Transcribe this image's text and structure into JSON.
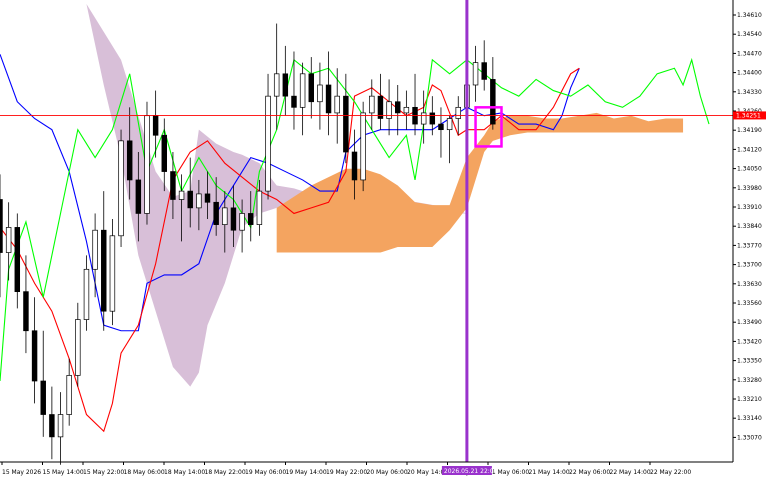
{
  "chart_data": {
    "type": "candlestick",
    "title": "",
    "xlabel": "",
    "ylabel": "",
    "ylim": [
      1.3301,
      1.3465
    ],
    "y_ticks": [
      "1.34610",
      "1.34540",
      "1.34470",
      "1.34400",
      "1.34330",
      "1.34260",
      "1.34190",
      "1.34120",
      "1.34050",
      "1.33980",
      "1.33910",
      "1.33840",
      "1.33770",
      "1.33700",
      "1.33630",
      "1.33560",
      "1.33490",
      "1.33420",
      "1.33350",
      "1.33280",
      "1.33210",
      "1.33140",
      "1.33070"
    ],
    "x_ticks": [
      "15 May 2026",
      "15 May 14:00",
      "15 May 22:00",
      "18 May 06:00",
      "18 May 14:00",
      "18 May 22:00",
      "19 May 06:00",
      "19 May 14:00",
      "19 May 22:00",
      "20 May 06:00",
      "20 May 14:00",
      "20 May 22:00",
      "21 May 06:00",
      "21 May 14:00",
      "22 May 06:00",
      "22 May 14:00",
      "22 May 22:00"
    ],
    "current_price": "1.34251",
    "current_price_value": 1.34251,
    "marker_label": "2026.05.21 22:00",
    "grid": false,
    "colors": {
      "background": "#ffffff",
      "tenkan": "#ff0000",
      "kijun": "#0000ff",
      "chikou": "#00ff00",
      "cloud_bear": "#d8bfd8",
      "cloud_bull": "#f4a460",
      "marker_line": "#9932cc",
      "box": "#ff00ff",
      "price_line": "#ff0000",
      "candle": "#000000"
    },
    "series": [
      {
        "name": "kumo_bear_top",
        "points": [
          [
            10,
            1.3465
          ],
          [
            12,
            1.3455
          ],
          [
            14,
            1.3445
          ],
          [
            16,
            1.3425
          ],
          [
            18,
            1.3405
          ],
          [
            20,
            1.3396
          ],
          [
            22,
            1.3398
          ],
          [
            23,
            1.342
          ],
          [
            25,
            1.3415
          ],
          [
            27,
            1.3412
          ],
          [
            28,
            1.3411
          ],
          [
            30,
            1.3408
          ],
          [
            32,
            1.34
          ],
          [
            34,
            1.3399
          ],
          [
            36,
            1.3397
          ],
          [
            37,
            1.34
          ],
          [
            52,
            1.3392
          ],
          [
            54,
            1.339
          ]
        ]
      },
      {
        "name": "kumo_bear_bottom",
        "points": [
          [
            10,
            1.3465
          ],
          [
            12,
            1.3436
          ],
          [
            14,
            1.341
          ],
          [
            16,
            1.3375
          ],
          [
            18,
            1.3355
          ],
          [
            20,
            1.3335
          ],
          [
            22,
            1.3328
          ],
          [
            23,
            1.3333
          ],
          [
            24,
            1.335
          ],
          [
            26,
            1.3365
          ],
          [
            28,
            1.3385
          ],
          [
            30,
            1.339
          ],
          [
            32,
            1.3392
          ],
          [
            34,
            1.3394
          ],
          [
            36,
            1.3395
          ],
          [
            37,
            1.3395
          ],
          [
            52,
            1.339
          ],
          [
            54,
            1.339
          ]
        ]
      },
      {
        "name": "kumo_bull_top",
        "points": [
          [
            32,
            1.3392
          ],
          [
            36,
            1.34
          ],
          [
            38,
            1.3403
          ],
          [
            40,
            1.3406
          ],
          [
            42,
            1.3406
          ],
          [
            44,
            1.3404
          ],
          [
            46,
            1.34
          ],
          [
            48,
            1.3394
          ],
          [
            50,
            1.3393
          ],
          [
            52,
            1.3393
          ],
          [
            54,
            1.341
          ],
          [
            56,
            1.3418
          ],
          [
            57,
            1.3423
          ],
          [
            59,
            1.3425
          ],
          [
            61,
            1.3425
          ],
          [
            63,
            1.3424
          ],
          [
            65,
            1.3424
          ],
          [
            67,
            1.3425
          ],
          [
            69,
            1.3426
          ],
          [
            71,
            1.3424
          ],
          [
            73,
            1.3425
          ],
          [
            75,
            1.3423
          ],
          [
            77,
            1.3424
          ],
          [
            79,
            1.3424
          ]
        ]
      },
      {
        "name": "kumo_bull_bottom",
        "points": [
          [
            32,
            1.3376
          ],
          [
            34,
            1.3376
          ],
          [
            36,
            1.3376
          ],
          [
            40,
            1.3376
          ],
          [
            44,
            1.3376
          ],
          [
            46,
            1.3378
          ],
          [
            48,
            1.3378
          ],
          [
            50,
            1.3378
          ],
          [
            52,
            1.3384
          ],
          [
            54,
            1.3392
          ],
          [
            56,
            1.3412
          ],
          [
            57,
            1.3416
          ],
          [
            59,
            1.3418
          ],
          [
            61,
            1.3419
          ],
          [
            63,
            1.3419
          ],
          [
            65,
            1.3419
          ],
          [
            67,
            1.3419
          ],
          [
            69,
            1.3419
          ],
          [
            71,
            1.3419
          ],
          [
            73,
            1.3419
          ],
          [
            75,
            1.3419
          ],
          [
            77,
            1.3419
          ],
          [
            79,
            1.3419
          ]
        ]
      },
      {
        "name": "kijun",
        "points": [
          [
            0,
            1.3447
          ],
          [
            2,
            1.343
          ],
          [
            4,
            1.3424
          ],
          [
            6,
            1.342
          ],
          [
            8,
            1.3405
          ],
          [
            10,
            1.338
          ],
          [
            12,
            1.335
          ],
          [
            14,
            1.3348
          ],
          [
            16,
            1.3348
          ],
          [
            17,
            1.3365
          ],
          [
            19,
            1.3368
          ],
          [
            21,
            1.3368
          ],
          [
            23,
            1.3372
          ],
          [
            25,
            1.339
          ],
          [
            27,
            1.34
          ],
          [
            29,
            1.341
          ],
          [
            31,
            1.3408
          ],
          [
            33,
            1.3405
          ],
          [
            35,
            1.3402
          ],
          [
            37,
            1.3398
          ],
          [
            39,
            1.3398
          ],
          [
            40,
            1.3412
          ],
          [
            42,
            1.3418
          ],
          [
            44,
            1.342
          ],
          [
            46,
            1.342
          ],
          [
            48,
            1.342
          ],
          [
            50,
            1.342
          ],
          [
            52,
            1.3424
          ],
          [
            54,
            1.3428
          ],
          [
            56,
            1.3425
          ],
          [
            58,
            1.3426
          ],
          [
            60,
            1.3422
          ],
          [
            62,
            1.3422
          ],
          [
            64,
            1.342
          ],
          [
            65,
            1.3425
          ],
          [
            66,
            1.3435
          ],
          [
            67,
            1.3442
          ]
        ]
      },
      {
        "name": "tenkan",
        "points": [
          [
            0,
            1.3385
          ],
          [
            2,
            1.3377
          ],
          [
            4,
            1.3365
          ],
          [
            6,
            1.3355
          ],
          [
            8,
            1.3338
          ],
          [
            10,
            1.3318
          ],
          [
            12,
            1.3312
          ],
          [
            13,
            1.3322
          ],
          [
            14,
            1.334
          ],
          [
            16,
            1.335
          ],
          [
            18,
            1.3372
          ],
          [
            20,
            1.3402
          ],
          [
            22,
            1.3412
          ],
          [
            24,
            1.3416
          ],
          [
            26,
            1.3408
          ],
          [
            28,
            1.3403
          ],
          [
            30,
            1.3398
          ],
          [
            32,
            1.3395
          ],
          [
            34,
            1.339
          ],
          [
            36,
            1.3392
          ],
          [
            38,
            1.3394
          ],
          [
            40,
            1.3405
          ],
          [
            41,
            1.3432
          ],
          [
            43,
            1.3435
          ],
          [
            45,
            1.343
          ],
          [
            47,
            1.3425
          ],
          [
            49,
            1.3428
          ],
          [
            50,
            1.3436
          ],
          [
            51,
            1.3434
          ],
          [
            53,
            1.3418
          ],
          [
            54,
            1.342
          ],
          [
            56,
            1.342
          ],
          [
            58,
            1.3425
          ],
          [
            60,
            1.342
          ],
          [
            62,
            1.342
          ],
          [
            64,
            1.3428
          ],
          [
            66,
            1.344
          ],
          [
            67,
            1.3442
          ]
        ]
      },
      {
        "name": "chikou",
        "points": [
          [
            0,
            1.333
          ],
          [
            1,
            1.337
          ],
          [
            3,
            1.3387
          ],
          [
            5,
            1.336
          ],
          [
            7,
            1.339
          ],
          [
            9,
            1.342
          ],
          [
            11,
            1.341
          ],
          [
            13,
            1.342
          ],
          [
            15,
            1.344
          ],
          [
            17,
            1.3405
          ],
          [
            19,
            1.342
          ],
          [
            21,
            1.3398
          ],
          [
            23,
            1.341
          ],
          [
            25,
            1.34
          ],
          [
            27,
            1.3395
          ],
          [
            29,
            1.3385
          ],
          [
            30,
            1.3405
          ],
          [
            32,
            1.342
          ],
          [
            34,
            1.3445
          ],
          [
            36,
            1.344
          ],
          [
            38,
            1.3442
          ],
          [
            40,
            1.3434
          ],
          [
            41,
            1.343
          ],
          [
            43,
            1.342
          ],
          [
            45,
            1.341
          ],
          [
            47,
            1.3418
          ],
          [
            48,
            1.3402
          ],
          [
            49,
            1.3422
          ],
          [
            50,
            1.3445
          ],
          [
            52,
            1.344
          ],
          [
            54,
            1.3445
          ],
          [
            56,
            1.344
          ],
          [
            58,
            1.3435
          ],
          [
            60,
            1.3432
          ],
          [
            62,
            1.3438
          ],
          [
            64,
            1.3434
          ],
          [
            66,
            1.3432
          ],
          [
            68,
            1.3436
          ],
          [
            70,
            1.343
          ],
          [
            72,
            1.3428
          ],
          [
            74,
            1.3432
          ],
          [
            76,
            1.344
          ],
          [
            78,
            1.3442
          ],
          [
            79,
            1.3436
          ],
          [
            80,
            1.3445
          ],
          [
            81,
            1.3432
          ],
          [
            82,
            1.3422
          ]
        ]
      }
    ],
    "candles": [
      [
        0,
        1.3395,
        1.3404,
        1.336,
        1.3376
      ],
      [
        1,
        1.3376,
        1.3394,
        1.3366,
        1.3385
      ],
      [
        2,
        1.3385,
        1.339,
        1.3356,
        1.3362
      ],
      [
        3,
        1.3362,
        1.3375,
        1.334,
        1.3348
      ],
      [
        4,
        1.3348,
        1.336,
        1.3322,
        1.333
      ],
      [
        5,
        1.333,
        1.3348,
        1.331,
        1.3318
      ],
      [
        6,
        1.3318,
        1.3328,
        1.3302,
        1.331
      ],
      [
        7,
        1.331,
        1.3326,
        1.33,
        1.3318
      ],
      [
        8,
        1.3318,
        1.3338,
        1.3314,
        1.3332
      ],
      [
        9,
        1.3332,
        1.3358,
        1.3328,
        1.3352
      ],
      [
        10,
        1.3352,
        1.3375,
        1.3348,
        1.337
      ],
      [
        11,
        1.337,
        1.339,
        1.336,
        1.3384
      ],
      [
        12,
        1.3384,
        1.3398,
        1.3348,
        1.3355
      ],
      [
        13,
        1.3355,
        1.3388,
        1.335,
        1.3382
      ],
      [
        14,
        1.3382,
        1.342,
        1.3378,
        1.3416
      ],
      [
        15,
        1.3416,
        1.3428,
        1.3395,
        1.3402
      ],
      [
        16,
        1.3402,
        1.3412,
        1.338,
        1.339
      ],
      [
        17,
        1.339,
        1.343,
        1.3386,
        1.3425
      ],
      [
        18,
        1.3425,
        1.3434,
        1.341,
        1.3418
      ],
      [
        19,
        1.3418,
        1.3424,
        1.3398,
        1.3405
      ],
      [
        20,
        1.3405,
        1.3412,
        1.3388,
        1.3395
      ],
      [
        21,
        1.3395,
        1.3404,
        1.338,
        1.3398
      ],
      [
        22,
        1.3398,
        1.341,
        1.3385,
        1.3392
      ],
      [
        23,
        1.3392,
        1.3402,
        1.3384,
        1.3397
      ],
      [
        24,
        1.3397,
        1.3405,
        1.3388,
        1.3394
      ],
      [
        25,
        1.3394,
        1.3403,
        1.3382,
        1.3386
      ],
      [
        26,
        1.3386,
        1.3398,
        1.3376,
        1.3392
      ],
      [
        27,
        1.3392,
        1.34,
        1.3378,
        1.3384
      ],
      [
        28,
        1.3384,
        1.3395,
        1.3376,
        1.339
      ],
      [
        29,
        1.339,
        1.3398,
        1.338,
        1.3386
      ],
      [
        30,
        1.3386,
        1.3402,
        1.3382,
        1.3398
      ],
      [
        31,
        1.3398,
        1.344,
        1.3395,
        1.3432
      ],
      [
        32,
        1.3432,
        1.3458,
        1.342,
        1.344
      ],
      [
        33,
        1.344,
        1.345,
        1.3425,
        1.3432
      ],
      [
        34,
        1.3432,
        1.3448,
        1.342,
        1.3428
      ],
      [
        35,
        1.3428,
        1.3444,
        1.3418,
        1.344
      ],
      [
        36,
        1.344,
        1.3446,
        1.3424,
        1.343
      ],
      [
        37,
        1.343,
        1.3444,
        1.342,
        1.3436
      ],
      [
        38,
        1.3436,
        1.3448,
        1.3418,
        1.3426
      ],
      [
        39,
        1.3426,
        1.3442,
        1.3415,
        1.3432
      ],
      [
        40,
        1.3432,
        1.344,
        1.3408,
        1.3412
      ],
      [
        41,
        1.3412,
        1.342,
        1.3395,
        1.3402
      ],
      [
        42,
        1.3402,
        1.343,
        1.3398,
        1.3426
      ],
      [
        43,
        1.3426,
        1.3438,
        1.342,
        1.3432
      ],
      [
        44,
        1.3432,
        1.344,
        1.342,
        1.3424
      ],
      [
        45,
        1.3424,
        1.3438,
        1.3418,
        1.343
      ],
      [
        46,
        1.343,
        1.3436,
        1.3418,
        1.3426
      ],
      [
        47,
        1.3426,
        1.3434,
        1.342,
        1.3428
      ],
      [
        48,
        1.3428,
        1.344,
        1.3418,
        1.3422
      ],
      [
        49,
        1.3422,
        1.3434,
        1.3415,
        1.3426
      ],
      [
        50,
        1.3426,
        1.3432,
        1.3418,
        1.3422
      ],
      [
        51,
        1.3422,
        1.3428,
        1.341,
        1.342
      ],
      [
        52,
        1.342,
        1.3425,
        1.3408,
        1.3424
      ],
      [
        53,
        1.3424,
        1.3432,
        1.3418,
        1.3428
      ],
      [
        54,
        1.3428,
        1.344,
        1.3424,
        1.3436
      ],
      [
        55,
        1.3436,
        1.345,
        1.343,
        1.3444
      ],
      [
        56,
        1.3444,
        1.3452,
        1.3434,
        1.3438
      ],
      [
        57,
        1.3438,
        1.3446,
        1.342,
        1.3422
      ]
    ]
  }
}
